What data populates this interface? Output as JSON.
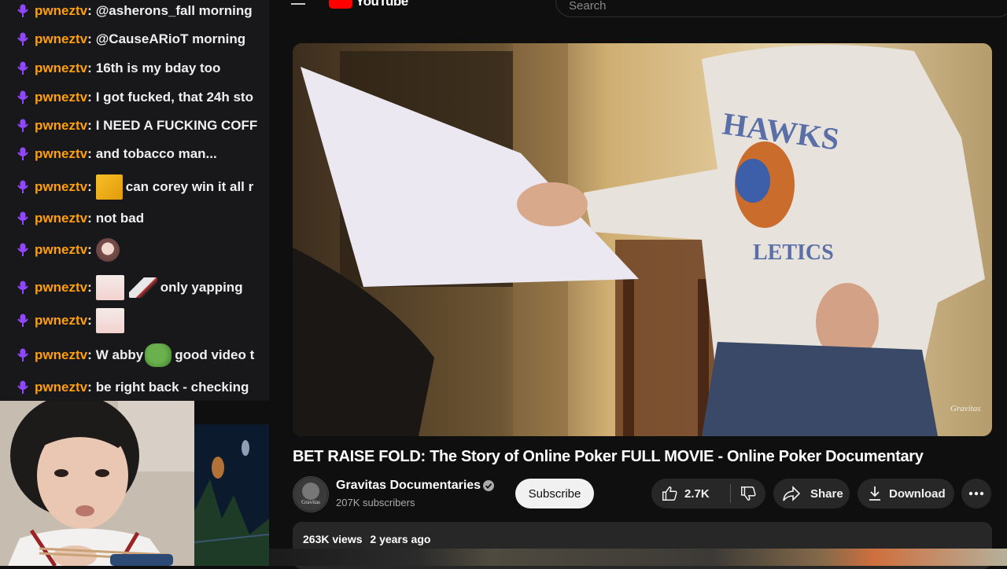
{
  "chat": {
    "messages": [
      {
        "user": "pwneztv",
        "parts": [
          {
            "t": "text",
            "v": "@asherons_fall morning"
          }
        ]
      },
      {
        "user": "pwneztv",
        "parts": [
          {
            "t": "text",
            "v": "@CauseARioT morning"
          }
        ]
      },
      {
        "user": "pwneztv",
        "parts": [
          {
            "t": "text",
            "v": "16th is my bday too"
          }
        ]
      },
      {
        "user": "pwneztv",
        "parts": [
          {
            "t": "text",
            "v": "I got fucked, that 24h sto"
          }
        ]
      },
      {
        "user": "pwneztv",
        "parts": [
          {
            "t": "text",
            "v": "I NEED A FUCKING COFF"
          }
        ]
      },
      {
        "user": "pwneztv",
        "parts": [
          {
            "t": "text",
            "v": "and tobacco man..."
          }
        ]
      },
      {
        "user": "pwneztv",
        "parts": [
          {
            "t": "emote",
            "v": "cat-emote"
          },
          {
            "t": "text",
            "v": "can corey win it all r"
          }
        ]
      },
      {
        "user": "pwneztv",
        "parts": [
          {
            "t": "text",
            "v": "not bad"
          }
        ]
      },
      {
        "user": "pwneztv",
        "parts": [
          {
            "t": "emote",
            "v": "anime-girl-emote"
          }
        ]
      },
      {
        "user": "pwneztv",
        "parts": [
          {
            "t": "emote",
            "v": "blush-emote"
          },
          {
            "t": "emote",
            "v": "yapping-emote"
          },
          {
            "t": "text",
            "v": "only yapping"
          }
        ]
      },
      {
        "user": "pwneztv",
        "parts": [
          {
            "t": "emote",
            "v": "blush-emote"
          }
        ]
      },
      {
        "user": "pwneztv",
        "parts": [
          {
            "t": "text",
            "v": "W abby"
          },
          {
            "t": "emote",
            "v": "pepe-emote"
          },
          {
            "t": "text",
            "v": "good video t"
          }
        ]
      },
      {
        "user": "pwneztv",
        "parts": [
          {
            "t": "text",
            "v": "be right back - checking"
          }
        ]
      }
    ]
  },
  "youtube": {
    "logo_text": "YouTube",
    "search_placeholder": "Search",
    "video_title": "BET RAISE FOLD: The Story of Online Poker FULL MOVIE - Online Poker Documentary",
    "watermark": "Gravitas",
    "channel": {
      "name": "Gravitas Documentaries",
      "subscribers": "207K subscribers",
      "avatar_text": "Gravitas"
    },
    "actions": {
      "subscribe": "Subscribe",
      "likes": "2.7K",
      "share": "Share",
      "download": "Download"
    },
    "description": {
      "views": "263K views",
      "age": "2 years ago"
    }
  },
  "colors": {
    "username": "#ff9f0a",
    "badge": "#9146ff",
    "yt_bg": "#0f0f0f",
    "chat_bg": "#18181b"
  }
}
